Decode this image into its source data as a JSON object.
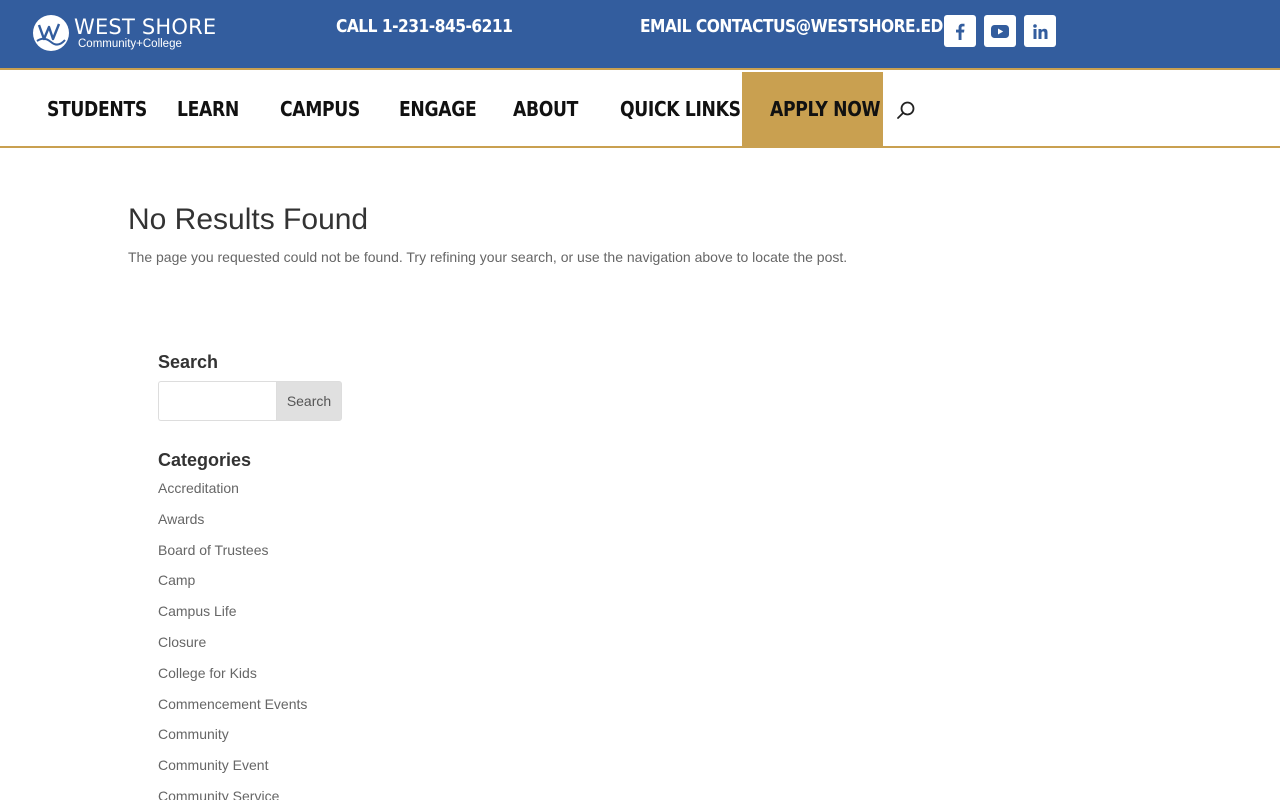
{
  "header": {
    "logo_title": "WEST SHORE",
    "logo_subtitle": "Community+College",
    "call": "CALL 1-231-845-6211",
    "email": "EMAIL CONTACTUS@WESTSHORE.EDU",
    "social": [
      "facebook-icon",
      "youtube-icon",
      "linkedin-icon"
    ],
    "colors": {
      "brand_blue": "#335d9e",
      "accent_gold": "#c9a050"
    }
  },
  "nav": {
    "items": [
      "STUDENTS",
      "LEARN",
      "CAMPUS",
      "ENGAGE",
      "ABOUT",
      "QUICK LINKS"
    ],
    "cta": "APPLY NOW",
    "search_icon": "search-icon"
  },
  "main": {
    "title": "No Results Found",
    "message": "The page you requested could not be found. Try refining your search, or use the navigation above to locate the post."
  },
  "sidebar": {
    "search_title": "Search",
    "search_value": "",
    "search_button": "Search",
    "categories_title": "Categories",
    "categories": [
      "Accreditation",
      "Awards",
      "Board of Trustees",
      "Camp",
      "Campus Life",
      "Closure",
      "College for Kids",
      "Commencement Events",
      "Community",
      "Community Event",
      "Community Service"
    ]
  }
}
